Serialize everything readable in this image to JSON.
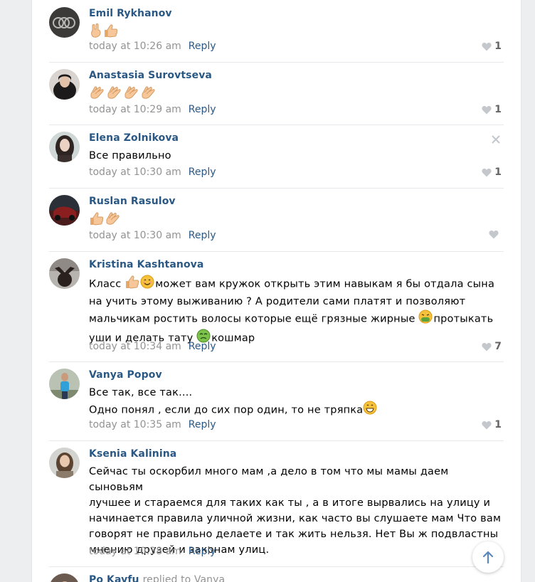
{
  "comments": [
    {
      "author": "Emil Rykhanov",
      "text_parts": [],
      "emojis": [
        "hand-ok",
        "thumbs-up"
      ],
      "time": "today at 10:26 am",
      "reply": "Reply",
      "likes": "1"
    },
    {
      "author": "Anastasia Surovtseva",
      "emojis": [
        "clap",
        "clap",
        "clap",
        "clap"
      ],
      "time": "today at 10:29 am",
      "reply": "Reply",
      "likes": "1"
    },
    {
      "author": "Elena Zolnikova",
      "text": "Все правильно",
      "time": "today at 10:30 am",
      "reply": "Reply",
      "likes": "1"
    },
    {
      "author": "Ruslan Rasulov",
      "emojis": [
        "thumbs-up",
        "clap"
      ],
      "time": "today at 10:30 am",
      "reply": "Reply",
      "likes": ""
    },
    {
      "author": "Kristina Kashtanova",
      "line1a": "Класс",
      "line1b": "может вам кружок открыть этим навыкам я бы отдала сына",
      "line2": "на учить этому выживанию ? А родители сами платят и позволяют",
      "line3a": "мальчикам ростить волосы которые ещё грязные жирные",
      "line3b": "протыкать",
      "line4a": "уши и делать тату",
      "line4b": "кошмар",
      "time": "today at 10:34 am",
      "reply": "Reply",
      "likes": "7"
    },
    {
      "author": "Vanya Popov",
      "line1": "Все так, все так....",
      "line2": "Одно понял , если до сих пор один, то не тряпка",
      "time": "today at 10:35 am",
      "reply": "Reply",
      "likes": "1"
    },
    {
      "author": "Ksenia Kalinina",
      "lines": [
        "Сейчас ты оскорбил много мам ,а дело в том что мы мамы даем сыновьям",
        "лучшее и стараемся для таких как ты , а в итоге вырвались на улицу и",
        "начинается правила уличной жизни, как часто вы слушаете мам Что вам",
        "говорят не правильно делаете и так жить нельзя. Нет Вы ж подвластны",
        "мнению друзей и законам улиц."
      ],
      "time": "today at 10:38 am",
      "reply": "Reply",
      "likes": ""
    },
    {
      "author": "Po Kayfu",
      "replied": "replied to Vanya"
    }
  ],
  "colors": {
    "link": "#2a5885",
    "meta": "#939393",
    "heart": "#c4c8cd"
  }
}
